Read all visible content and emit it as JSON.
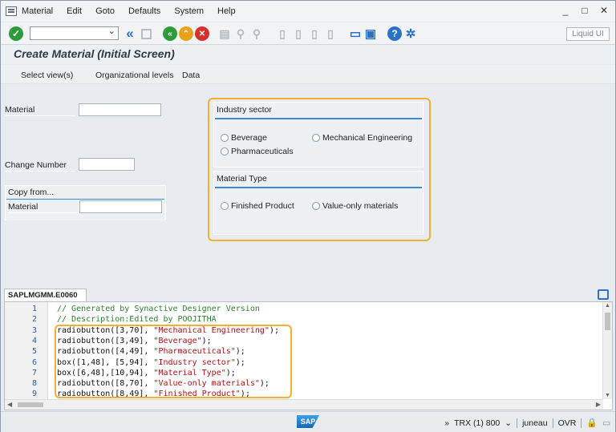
{
  "menubar": {
    "items": [
      "Material",
      "Edit",
      "Goto",
      "Defaults",
      "System",
      "Help"
    ],
    "window_controls": [
      "_",
      "□",
      "✕"
    ]
  },
  "toolbar": {
    "command_field_value": "",
    "liquid_ui_label": "Liquid UI",
    "icons": [
      "enter-icon",
      "back-double-icon",
      "save-icon",
      "back-icon",
      "exit-icon",
      "cancel-icon",
      "print-icon",
      "find-icon",
      "first-page-icon",
      "prev-page-icon",
      "next-page-icon",
      "last-page-icon",
      "new-session-icon",
      "shortcut-icon",
      "help-icon",
      "settings-icon"
    ]
  },
  "title": "Create Material (Initial Screen)",
  "app_toolbar": {
    "items": [
      "Select view(s)",
      "Organizational levels",
      "Data"
    ]
  },
  "form": {
    "material_label": "Material",
    "material_value": "",
    "change_number_label": "Change Number",
    "change_number_value": "",
    "copy_from": {
      "title": "Copy from...",
      "material_label": "Material",
      "material_value": ""
    },
    "industry_sector": {
      "title": "Industry sector",
      "options": [
        "Beverage",
        "Mechanical Engineering",
        "Pharmaceuticals"
      ],
      "selected": ""
    },
    "material_type": {
      "title": "Material Type",
      "options": [
        "Finished Product",
        "Value-only materials"
      ],
      "selected": ""
    }
  },
  "editor": {
    "tab_label": "SAPLMGMM.E0060",
    "lines": [
      {
        "num": "1",
        "text": "// Generated by Synactive Designer Version"
      },
      {
        "num": "2",
        "text": "// Description:Edited by POOJITHA"
      },
      {
        "num": "3",
        "pre": "radiobutton([3,70], ",
        "str": "\"Mechanical Engineering\"",
        "post": ");"
      },
      {
        "num": "4",
        "pre": "radiobutton([3,49], ",
        "str": "\"Beverage\"",
        "post": ");"
      },
      {
        "num": "5",
        "pre": "radiobutton([4,49], ",
        "str": "\"Pharmaceuticals\"",
        "post": ");"
      },
      {
        "num": "6",
        "pre": "box([1,48], [5,94], ",
        "str": "\"Industry sector\"",
        "post": ");"
      },
      {
        "num": "7",
        "pre": "box([6,48],[10,94], ",
        "str": "\"Material Type\"",
        "post": ");"
      },
      {
        "num": "8",
        "pre": "radiobutton([8,70], ",
        "str": "\"Value-only materials\"",
        "post": ");"
      },
      {
        "num": "9",
        "pre": "radiobutton([8,49], ",
        "str": "\"Finished Product\"",
        "post": ");"
      }
    ]
  },
  "statusbar": {
    "transaction": "TRX (1) 800",
    "server": "juneau",
    "mode": "OVR",
    "logo_text": "SAP"
  },
  "colors": {
    "highlight": "#f0b12e",
    "accent": "#2a72c6",
    "group_line": "#3a8bd6"
  }
}
